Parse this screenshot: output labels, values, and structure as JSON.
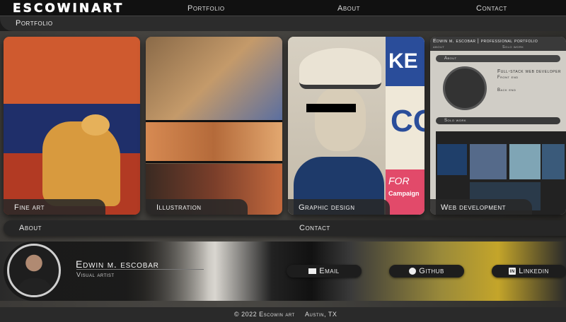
{
  "brand": {
    "logo": "ESCOWINART"
  },
  "nav": {
    "portfolio": "Portfolio",
    "about": "About",
    "contact": "Contact"
  },
  "section": {
    "portfolio": "Portfolio"
  },
  "cards": [
    {
      "label": "Fine art"
    },
    {
      "label": "Illustration"
    },
    {
      "label": "Graphic design",
      "poster_text_1": "KE",
      "poster_text_2": "CO",
      "poster_text_3": "FOR",
      "poster_text_4": "Campaign"
    },
    {
      "label": "Web development",
      "preview_title": "Edwin m. escobar | professional portfolio",
      "preview_nav_1": "about",
      "preview_nav_2": "Solo work",
      "preview_about": "About",
      "preview_role": "Full-stack web developer",
      "preview_front": "Front end",
      "preview_back": "Back end",
      "preview_solo": "Solo work"
    }
  ],
  "bars": {
    "about": "About",
    "contact": "Contact"
  },
  "profile": {
    "name": "Edwin m. escobar",
    "role": "Visual artist"
  },
  "links": {
    "email": "Email",
    "github": "Github",
    "linkedin": "Linkedin"
  },
  "footer": {
    "copyright": "© 2022 Escowin art",
    "location": "Austin, TX"
  }
}
